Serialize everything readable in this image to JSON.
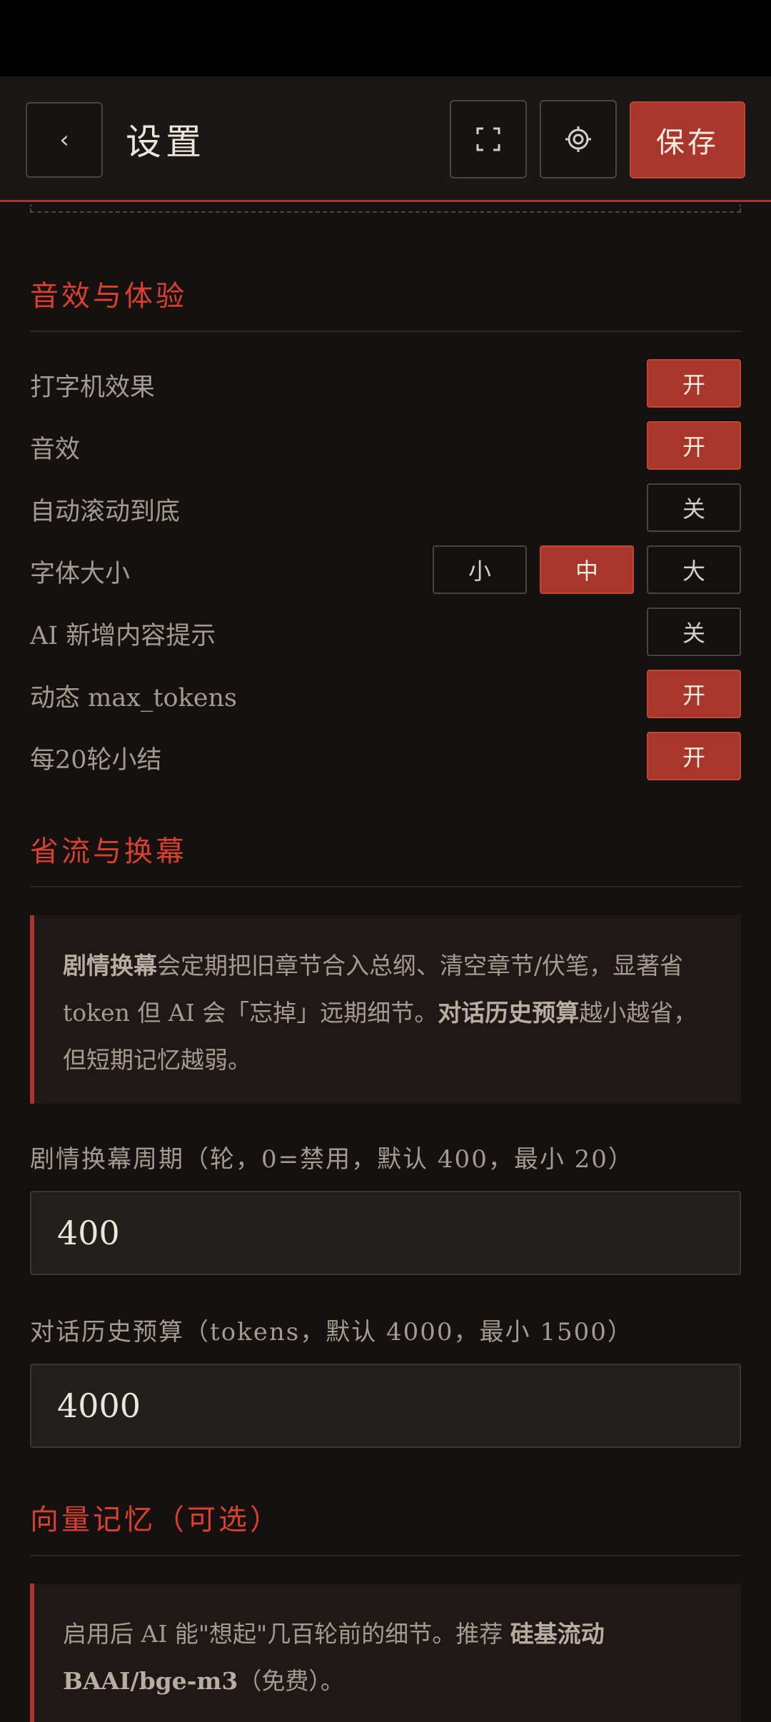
{
  "header": {
    "back_glyph": "‹",
    "title": "设置",
    "fullscreen_glyph": "⛶",
    "gear_glyph": "⚙",
    "save_label": "保存"
  },
  "sections": {
    "experience": {
      "title": "音效与体验",
      "typewriter": {
        "label": "打字机效果",
        "state": "开"
      },
      "sound": {
        "label": "音效",
        "state": "开"
      },
      "autoscroll": {
        "label": "自动滚动到底",
        "state": "关"
      },
      "fontsize": {
        "label": "字体大小",
        "small": "小",
        "medium": "中",
        "large": "大",
        "selected": "中"
      },
      "ai_hint": {
        "label": "AI 新增内容提示",
        "state": "关"
      },
      "dynamic_tokens": {
        "label": "动态 max_tokens",
        "state": "开"
      },
      "summary20": {
        "label": "每20轮小结",
        "state": "开"
      }
    },
    "saving": {
      "title": "省流与换幕",
      "info": {
        "b1": "剧情换幕",
        "t1": "会定期把旧章节合入总纲、清空章节/伏笔，显著省 token 但 AI 会「忘掉」远期细节。",
        "b2": "对话历史预算",
        "t2": "越小越省，但短期记忆越弱。"
      },
      "cycle_label": "剧情换幕周期（轮，0=禁用，默认 400，最小 20）",
      "cycle_value": "400",
      "budget_label": "对话历史预算（tokens，默认 4000，最小 1500）",
      "budget_value": "4000"
    },
    "vector": {
      "title": "向量记忆（可选）",
      "info": {
        "t1": "启用后 AI 能\"想起\"几百轮前的细节。推荐 ",
        "b1": "硅基流动 BAAI/bge-m3",
        "t2": "（免费）。"
      }
    }
  },
  "colors": {
    "accent": "#a8362a",
    "accent_text": "#d9402f",
    "background": "#141110"
  }
}
